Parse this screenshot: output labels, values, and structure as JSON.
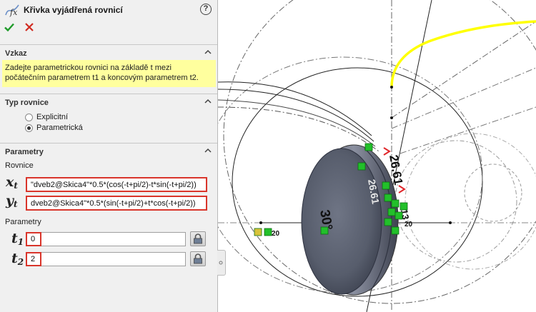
{
  "panel": {
    "title": "Křivka vyjádřená rovnicí",
    "help": "?"
  },
  "hint_section": {
    "title": "Vzkaz",
    "text": "Zadejte parametrickou rovnici na základě t mezi počátečním parametrem t1 a koncovým parametrem t2."
  },
  "type_section": {
    "title": "Typ rovnice",
    "options": [
      {
        "label": "Explicitní",
        "selected": false
      },
      {
        "label": "Parametrická",
        "selected": true
      }
    ]
  },
  "params_section": {
    "title": "Parametry",
    "equations_label": "Rovnice",
    "x_var": "x",
    "x_sub": "t",
    "y_var": "y",
    "y_sub": "t",
    "x_equation": "\"dveb2@Skica4\"*0.5*(cos(-t+pi/2)-t*sin(-t+pi/2))",
    "y_equation": "dveb2@Skica4\"*0.5*(sin(-t+pi/2)+t*cos(-t+pi/2))",
    "parameters_label": "Parametry",
    "t1_var": "t",
    "t1_sub": "1",
    "t1_value": "0",
    "t2_var": "t",
    "t2_sub": "2",
    "t2_value": "2"
  },
  "viewport": {
    "angle_label": "30°",
    "dim_label": "26.61",
    "dim_label_small": "13",
    "coord_label": "20",
    "coord_label_2": "20"
  },
  "colors": {
    "highlight_border": "#d9352b",
    "hint_bg": "#ffff9e",
    "curve": "#ffff00",
    "relation_marker": "#22c02a"
  }
}
